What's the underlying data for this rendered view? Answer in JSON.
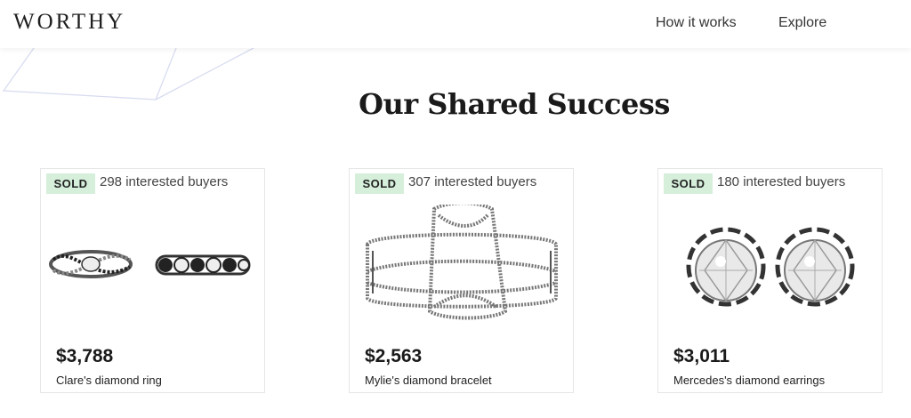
{
  "header": {
    "logo": "WORTHY",
    "nav": [
      {
        "label": "How it works"
      },
      {
        "label": "Explore"
      }
    ]
  },
  "section": {
    "title": "Our Shared Success"
  },
  "cards": [
    {
      "badge": "SOLD",
      "buyers": "298 interested buyers",
      "price": "$3,788",
      "title": "Clare's diamond ring",
      "image": "diamond-rings-image"
    },
    {
      "badge": "SOLD",
      "buyers": "307 interested buyers",
      "price": "$2,563",
      "title": "Mylie's diamond bracelet",
      "image": "diamond-bracelet-image"
    },
    {
      "badge": "SOLD",
      "buyers": "180 interested buyers",
      "price": "$3,011",
      "title": "Mercedes's diamond earrings",
      "image": "diamond-earrings-image"
    }
  ],
  "colors": {
    "sold_badge_bg": "#d6efdb",
    "decor_lines": "#d8dcf0"
  }
}
